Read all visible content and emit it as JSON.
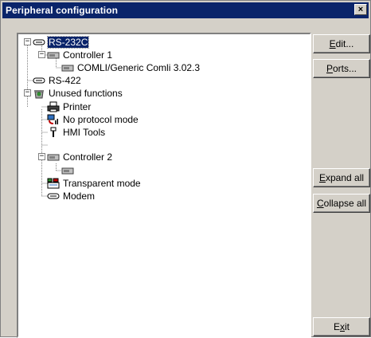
{
  "window": {
    "title": "Peripheral configuration",
    "close_glyph": "×"
  },
  "tree": {
    "nodes": [
      {
        "label": "RS-232C",
        "icon": "serial-port-icon",
        "selected": true,
        "expander": "−"
      },
      {
        "label": "Controller 1",
        "icon": "controller-icon",
        "expander": "−"
      },
      {
        "label": "COMLI/Generic Comli 3.02.3",
        "icon": "controller-icon"
      },
      {
        "label": "RS-422",
        "icon": "serial-port-icon"
      },
      {
        "label": "Unused functions",
        "icon": "unused-functions-icon",
        "expander": "−"
      },
      {
        "label": "Printer",
        "icon": "printer-icon"
      },
      {
        "label": "No protocol mode",
        "icon": "no-protocol-icon"
      },
      {
        "label": "HMI Tools",
        "icon": "hmi-tools-icon"
      },
      {
        "label": "Controller 2",
        "icon": "controller-icon",
        "expander": "−"
      },
      {
        "label": "",
        "icon": "controller-icon"
      },
      {
        "label": "Transparent mode",
        "icon": "transparent-mode-icon"
      },
      {
        "label": "Modem",
        "icon": "modem-icon"
      }
    ]
  },
  "buttons": {
    "edit": {
      "pre": "",
      "mnemonic": "E",
      "post": "dit..."
    },
    "ports": {
      "pre": "",
      "mnemonic": "P",
      "post": "orts..."
    },
    "expand_all": {
      "pre": "",
      "mnemonic": "E",
      "post": "xpand all"
    },
    "collapse_all": {
      "pre": "",
      "mnemonic": "C",
      "post": "ollapse all"
    },
    "exit": {
      "pre": "E",
      "mnemonic": "x",
      "post": "it"
    }
  },
  "colors": {
    "title_bar": "#0a246a",
    "dialog_face": "#d4d0c8",
    "selection": "#0a246a"
  }
}
